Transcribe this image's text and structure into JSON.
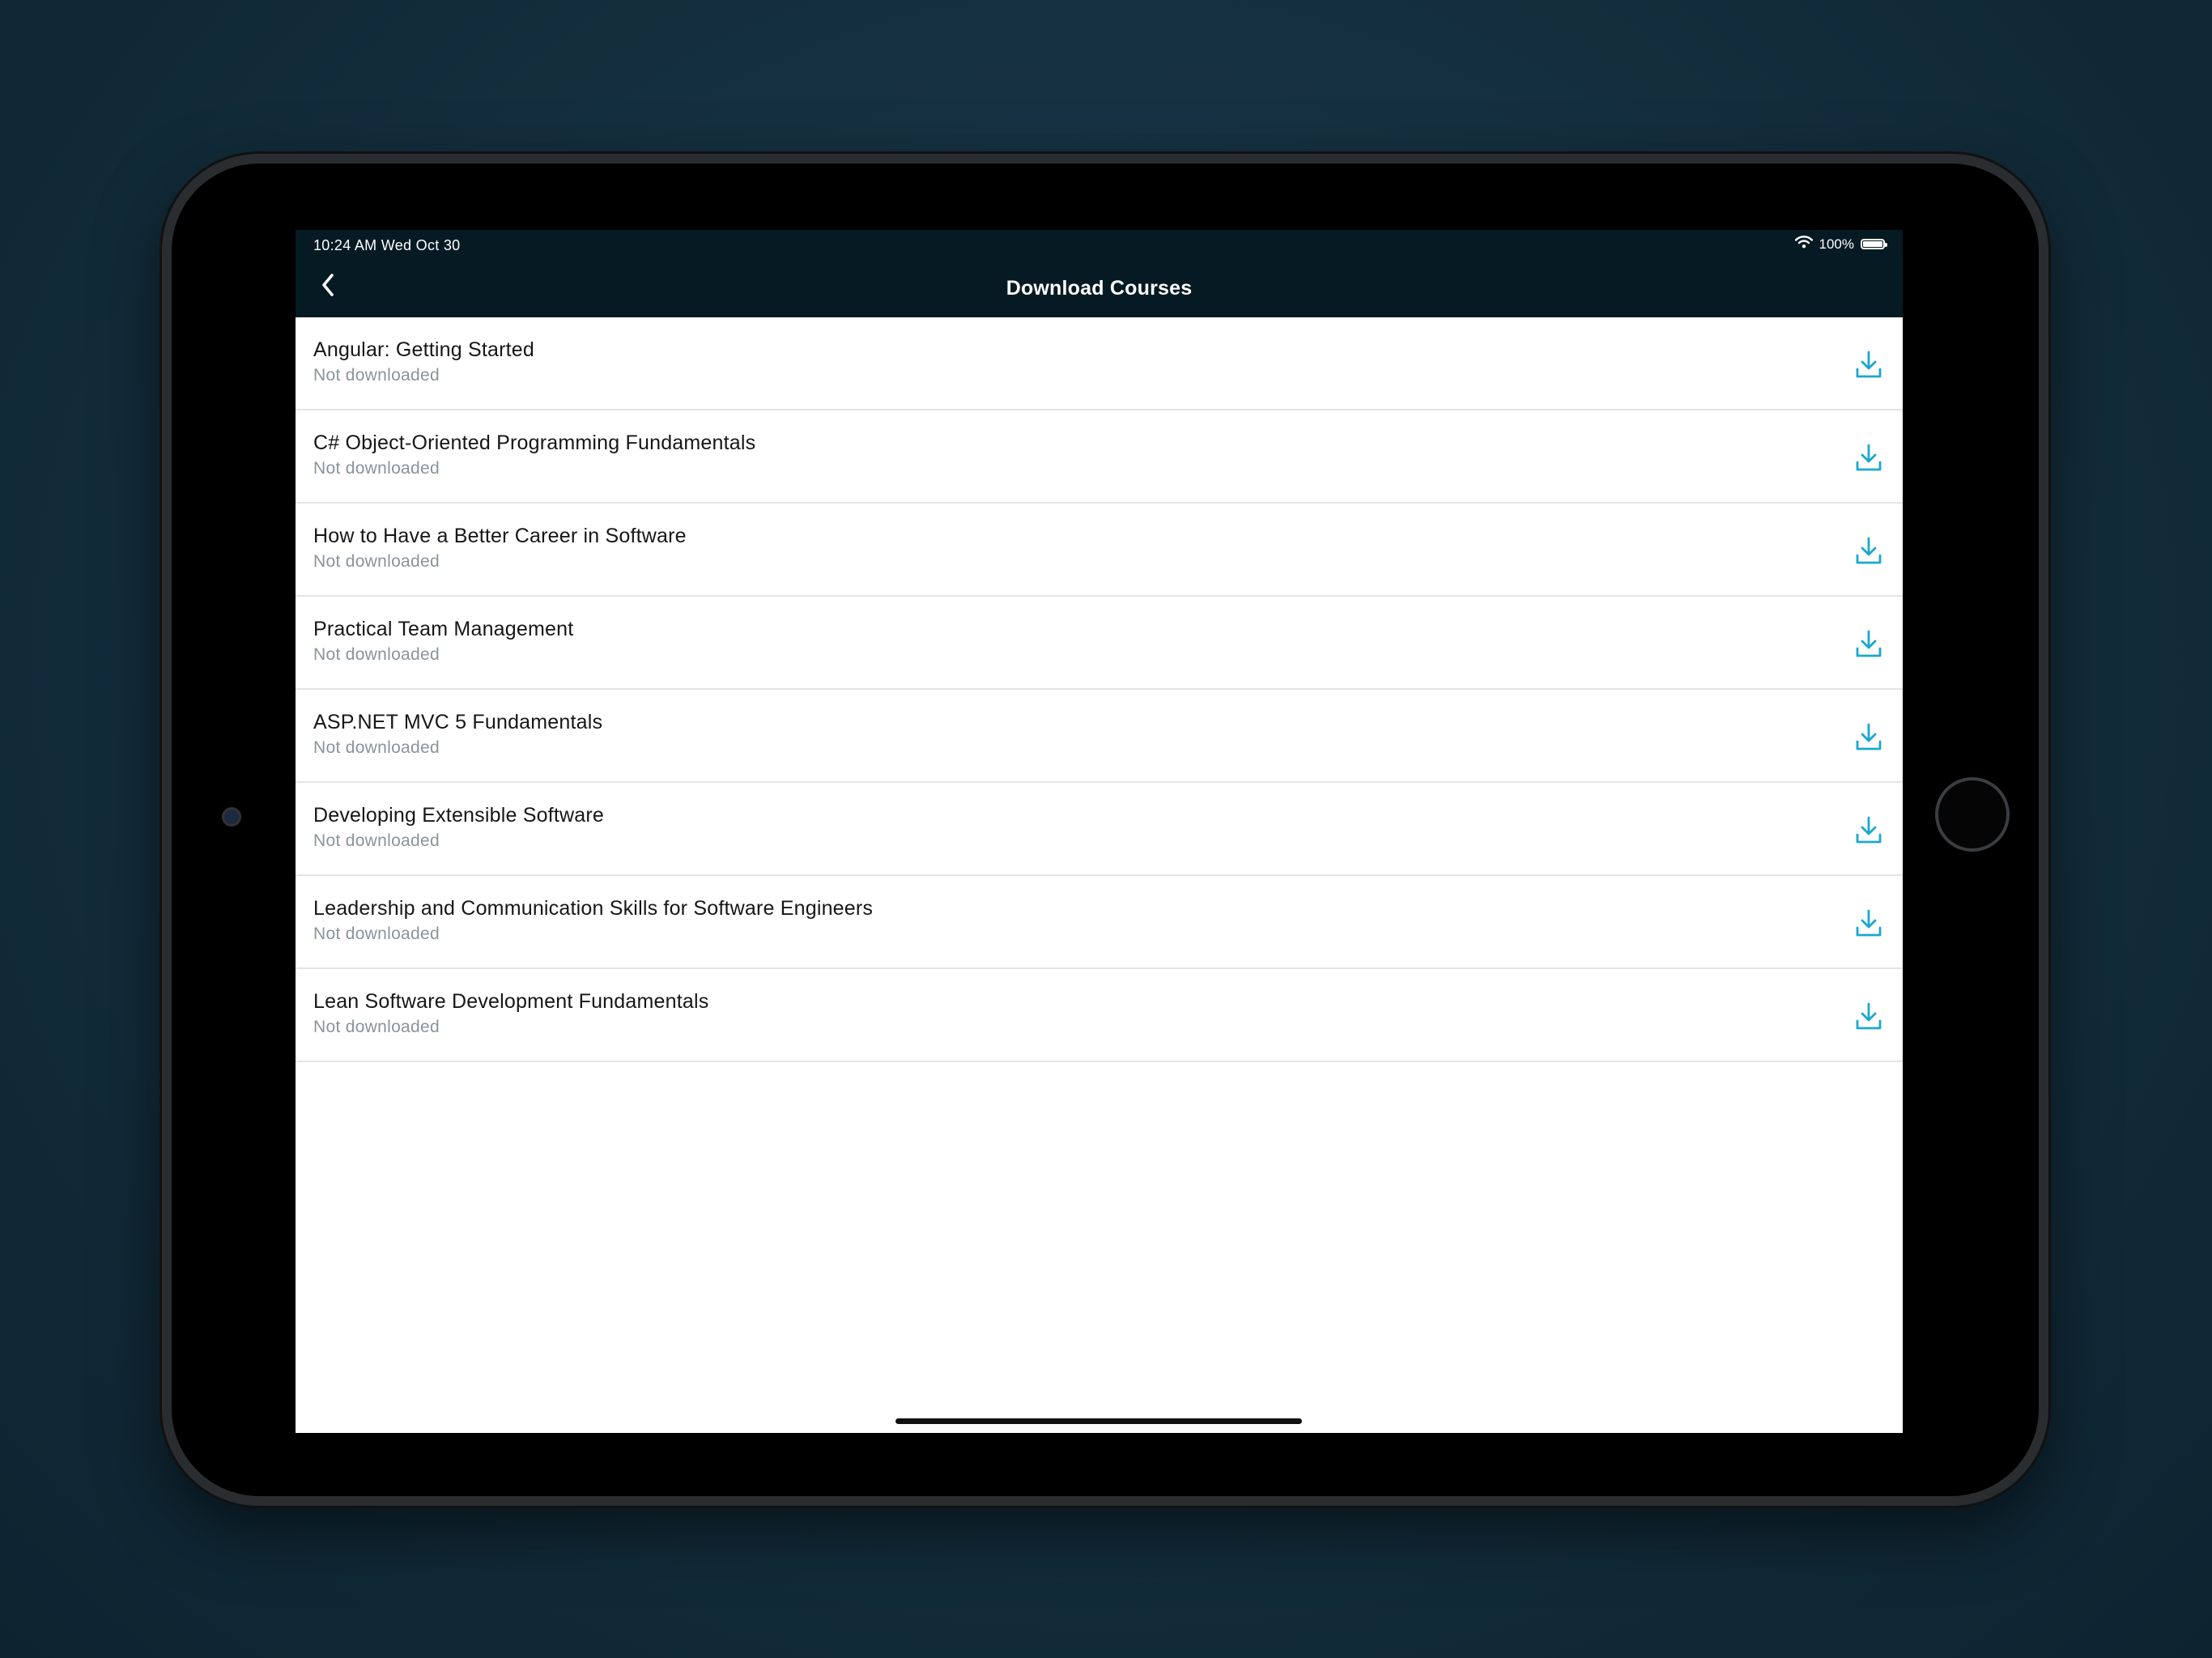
{
  "status_bar": {
    "time_date": "10:24 AM   Wed Oct 30",
    "battery": "100%"
  },
  "nav": {
    "title": "Download Courses"
  },
  "courses": [
    {
      "title": "Angular: Getting Started",
      "status": "Not downloaded"
    },
    {
      "title": "C# Object-Oriented Programming Fundamentals",
      "status": "Not downloaded"
    },
    {
      "title": "How to Have a Better Career in Software",
      "status": "Not downloaded"
    },
    {
      "title": "Practical Team Management",
      "status": "Not downloaded"
    },
    {
      "title": "ASP.NET MVC 5 Fundamentals",
      "status": "Not downloaded"
    },
    {
      "title": "Developing Extensible Software",
      "status": "Not downloaded"
    },
    {
      "title": "Leadership and Communication Skills for Software Engineers",
      "status": "Not downloaded"
    },
    {
      "title": "Lean Software Development Fundamentals",
      "status": "Not downloaded"
    }
  ],
  "icons": {
    "back": "chevron-left-icon",
    "download": "download-icon",
    "wifi": "wifi-icon",
    "battery": "battery-icon"
  },
  "colors": {
    "header_bg": "#061a24",
    "accent": "#1aa8cf",
    "subtitle": "#8a949c"
  }
}
